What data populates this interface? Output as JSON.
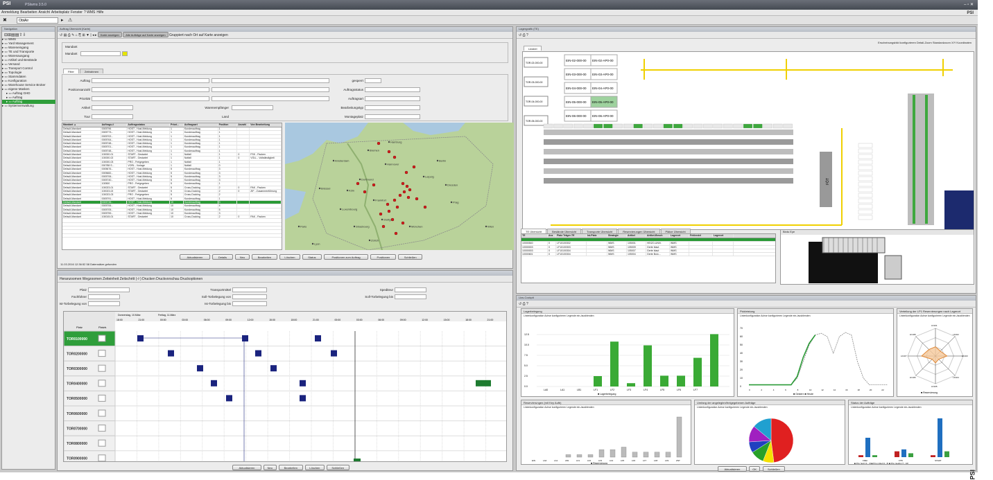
{
  "app": {
    "logo": "PSI",
    "title": "PSIwms 3.5.0",
    "brand": "PSI",
    "watermark": "PSI"
  },
  "menu": [
    "Anmeldung",
    "Bearbeiten",
    "Ansicht",
    "Arbeitsplatz",
    "Fenster",
    "? WMS",
    "Hilfe"
  ],
  "toolbar": {
    "search_value": "ObtAir"
  },
  "nav_panel": {
    "title": "Navigation"
  },
  "tree": [
    {
      "label": "WMS",
      "indent": 0
    },
    {
      "label": "Yard Management",
      "indent": 0
    },
    {
      "label": "Wareneingang",
      "indent": 0
    },
    {
      "label": "TE und Transporte",
      "indent": 0
    },
    {
      "label": "Warenausgang",
      "indent": 0
    },
    {
      "label": "Artikel und Bestände",
      "indent": 0
    },
    {
      "label": "Versand",
      "indent": 0
    },
    {
      "label": "Transport Control",
      "indent": 0
    },
    {
      "label": "Topologie",
      "indent": 0
    },
    {
      "label": "Stammdaten",
      "indent": 0
    },
    {
      "label": "Konfiguration",
      "indent": 0
    },
    {
      "label": "Warehouse Service Broker",
      "indent": 0
    },
    {
      "label": "eigene Masken",
      "indent": 0
    },
    {
      "label": "Auftrag GHD",
      "indent": 1
    },
    {
      "label": "Auftrag",
      "indent": 1
    },
    {
      "label": "Auftrag",
      "indent": 1,
      "selected": true
    },
    {
      "label": "Systemverwaltung",
      "indent": 0
    }
  ],
  "orders": {
    "panel_title": "Auftrag Übersicht (Karte)",
    "tb_buttons": [
      "Karte anzeigen",
      "Alle Aufträge auf Karte anzeigen"
    ],
    "tb_label": "Gruppiert nach Ort auf Karte anzeigen",
    "mandant_label": "Mandant",
    "tabs": [
      "Filter",
      "Zeitrahmen"
    ],
    "filter_labels": {
      "auftrag": "Auftrag",
      "positionsanzahl": "Positionsanzahl",
      "prioritaet": "Priorität",
      "artikel": "Artikel",
      "tour": "Tour",
      "gesperrt": "gesperrt",
      "auftragsstatus": "Auftragsstatus",
      "auftragsart": "Auftragsart",
      "bearbeitungstyp": "Bearbeitungstyp",
      "warenempfaenger": "Warenempfänger",
      "land": "Land",
      "montageplatz": "Montageplatz"
    },
    "columns": [
      "Mandant ▲",
      "Auftrags-#",
      "Auftragsstatus",
      "Priori...",
      "Auftragsart",
      "Position",
      "Anzahl",
      "Von Bearbeitung"
    ],
    "rows": [
      [
        "Default-Mandant",
        "0005796",
        "HOST - Host-Meldung",
        "1",
        "Kundenauftrag",
        "1",
        "",
        ""
      ],
      [
        "Default-Mandant",
        "0005773...",
        "HOST - Host-Meldung",
        "1",
        "Kundenauftrag",
        "1",
        "",
        ""
      ],
      [
        "Default-Mandant",
        "0005702...",
        "HOST - Host-Meldung",
        "1",
        "Kundenauftrag",
        "1",
        "",
        ""
      ],
      [
        "Default-Mandant",
        "0005764...",
        "HOST - Host-Meldung",
        "1",
        "Kundenauftrag",
        "1",
        "",
        ""
      ],
      [
        "Default-Mandant",
        "0005748...",
        "HOST - Host-Meldung",
        "1",
        "Kundenauftrag",
        "1",
        "",
        ""
      ],
      [
        "Default-Mandant",
        "0005701...",
        "HOST - Host-Meldung",
        "1",
        "Kundenauftrag",
        "1",
        "",
        ""
      ],
      [
        "Default-Mandant",
        "0005748...",
        "HOST - Host-Meldung",
        "1",
        "Kundenauftrag",
        "1",
        "",
        ""
      ],
      [
        "Default-Mandant",
        "100000-01",
        "START - Gestartet",
        "1",
        "Notfall",
        "1",
        "0",
        "FSK - Packen"
      ],
      [
        "Default-Mandant",
        "100000-02",
        "START - Gestartet",
        "1",
        "Notfall",
        "1",
        "0",
        "VOLL - Vollständigkeit"
      ],
      [
        "Default-Mandant",
        "100000-03",
        "PRO - Freigegeben",
        "1",
        "Notfall",
        "1",
        "",
        ""
      ],
      [
        "Default-Mandant",
        "000788 S...",
        "VORL - Vorlage",
        "1",
        "Notfall",
        "0",
        "",
        ""
      ],
      [
        "Default-Mandant",
        "0005676...",
        "HOST - Host-Meldung",
        "5",
        "Kundenauftrag",
        "3",
        "",
        ""
      ],
      [
        "Default-Mandant",
        "0005682...",
        "HOST - Host-Meldung",
        "5",
        "Kundenauftrag",
        "3",
        "",
        ""
      ],
      [
        "Default-Mandant",
        "0005706...",
        "HOST - Host-Meldung",
        "5",
        "Kundenauftrag",
        "3",
        "",
        ""
      ],
      [
        "Default-Mandant",
        "0005740...",
        "HOST - Host-Meldung",
        "5",
        "Kundenauftrag",
        "3",
        "",
        ""
      ],
      [
        "Default-Mandant",
        "100500",
        "PRO - Freigegeben",
        "5",
        "Kundenauftrag",
        "1",
        "",
        ""
      ],
      [
        "Default-Mandant",
        "100023-01",
        "START - Gestartet",
        "5",
        "Cross-Docking",
        "2",
        "0",
        "PAK - Packen"
      ],
      [
        "Default-Mandant",
        "100023-02",
        "START - Gestartet",
        "5",
        "Cross-Docking",
        "2",
        "0",
        "ZIF - Zusammenführung"
      ],
      [
        "Default-Mandant",
        "100023-03",
        "PRO - Freigegeben",
        "5",
        "Cross-Docking",
        "2",
        "",
        ""
      ],
      [
        "Default-Mandant",
        "0005791...",
        "HOST - Host-Meldung",
        "5",
        "Kundenauftrag",
        "1",
        "",
        ""
      ],
      [
        "Default-Mandant",
        "0005736...",
        "HOST - Host-Meldung",
        "10",
        "Kundenauftrag",
        "3",
        "",
        ""
      ],
      [
        "Default-Mandant",
        "0005706...",
        "HOST - Host-Meldung",
        "10",
        "Kundenauftrag",
        "4",
        "",
        ""
      ],
      [
        "Default-Mandant",
        "0005705...",
        "HOST - Host-Meldung",
        "10",
        "Kundenauftrag",
        "5",
        "",
        ""
      ],
      [
        "Default-Mandant",
        "0005759...",
        "HOST - Host-Meldung",
        "10",
        "Kundenauftrag",
        "3",
        "",
        ""
      ],
      [
        "Default-Mandant",
        "100015-01",
        "START - Gestartet",
        "10",
        "Cross-Docking",
        "2",
        "0",
        "PAK - Packen"
      ]
    ],
    "selected_row": 20,
    "buttons": [
      "Aktualisieren",
      "Details",
      "Neu",
      "Bearbeiten",
      "Löschen",
      "Status",
      "Positionen zum Auftrag",
      "Positionen",
      "Schließen"
    ],
    "status": "11.03.2016 12:36:52   58 Datensätze gefunden"
  },
  "map": {
    "cities": [
      "Hamburg",
      "Bremen",
      "Berlin",
      "Hannover",
      "Dortmund",
      "Leipzig",
      "Köln",
      "Dresden",
      "Frankfurt",
      "Prag",
      "Stuttgart",
      "München",
      "Zürich",
      "Wien",
      "Paris",
      "Amsterdam",
      "Brüssel",
      "Luxembourg",
      "Strasbourg",
      "Lyon"
    ]
  },
  "schedule": {
    "toolbar": "Heranzoomen  Wegzoomen  Zeiteinheit  Zeitschritt (-/-)  Drucken  Druckvorschau  Druckoptionen",
    "labels": {
      "platz": "Platz",
      "fachfuehrer": "Fachführer",
      "ist_torbelegung_von": "Ist-Torbelegung von",
      "transportmittel": "Transportmittel",
      "soll_torbelegung_von": "Soll-Torbelegung von",
      "ist_torbelegung_bis": "Ist-Torbelegung bis",
      "spediteur": "Spediteur",
      "soll_torbelegung_bis": "Soll-Torbelegung bis"
    },
    "col_platz": "Platz",
    "col_platzb": "Platzb.",
    "day1": "Donnerstag, 10.März",
    "day2": "Freitag, 11.März",
    "hours": [
      "18:00",
      "21:00",
      "00:00",
      "03:00",
      "06:00",
      "09:00",
      "12:00",
      "15:00",
      "18:00",
      "21:00",
      "00:00",
      "03:00",
      "06:00",
      "09:00",
      "12:00",
      "15:00",
      "18:00",
      "21:00"
    ],
    "gates": [
      "TOR0100000",
      "TOR0200000",
      "TOR0300000",
      "TOR0400000",
      "TOR0500000",
      "TOR0600000",
      "TOR0700000",
      "TOR0800000",
      "TOR0900000"
    ],
    "buttons": [
      "Aktualisieren",
      "Neu",
      "Bearbeiten",
      "Löschen",
      "Schließen"
    ]
  },
  "layout": {
    "panel_title": "Lagergrafik (TE)",
    "tb_right": "Erscheinungsbild konfigurieren   Detail-Zoom  Standardzoom   X/Y Koordinaten",
    "tab": "Lkwbel",
    "slot_labels": [
      "EIN-02-000-00",
      "EIN-02-AP0-00",
      "EIN-03-000-00",
      "EIN-03-AP0-00",
      "EIN-04-000-00",
      "EIN-04-AP0-00",
      "EIN-05-000-00",
      "EIN-05-AP0-00",
      "EIN-06-000-00",
      "EIN-06-AP0-00"
    ],
    "tor_labels": [
      "TOR-02-000-00",
      "TOR-03-000-00",
      "TOR-04-000-00",
      "TOR-05-000-00"
    ],
    "fot_label": "FÖT"
  },
  "stock": {
    "tabs": [
      "TE Übersicht",
      "Bestände Übersicht",
      "Transporte Übersicht",
      "Reservierungen Übersicht",
      "Plätze Übersicht"
    ],
    "columns": [
      "TE",
      "Anz",
      "Platz Träger-TE",
      "Ist-Platz",
      "Strategie",
      "Artikel",
      "Artikel-Besch",
      "Lagerort",
      "Fehlerziel",
      "Lagerort"
    ],
    "rows": [
      [
        "10000540",
        "0",
        "LF10100302",
        "",
        "WMS",
        "105001",
        "HEIZO-UNIV.",
        "WMS",
        "",
        ""
      ],
      [
        "10000003",
        "0",
        "LF10100303",
        "",
        "WMS",
        "105009",
        "Gerte blaut",
        "WMS",
        "",
        ""
      ],
      [
        "10000003",
        "0",
        "LF10100304",
        "",
        "WMS",
        "105007",
        "Gerte blaut",
        "WMS",
        "",
        ""
      ],
      [
        "10000601",
        "0",
        "LF10100304",
        "",
        "WMS",
        "105004",
        "Gerte Bolo...",
        "WMS",
        "",
        ""
      ]
    ],
    "birds_title": "Birds Eye"
  },
  "charts": {
    "panel_title": "Lkw-Cockpit",
    "cfg": "Linienkonfiguration  Achse konfigurieren  Legende ein-/ausblenden",
    "titles": [
      "Lagerbelegung",
      "Pickleistung",
      "Verteilung der LP1 Reservierungen nach Lagerort",
      "Reservierungen (mit Key Aufb)",
      "Umfang der angelegten/freigegebenen Aufträge",
      "Status der Aufträge"
    ],
    "legends": [
      "Lagerbelegung",
      "Gestern",
      "Heute",
      "Reservierung",
      "Reservierung",
      "Prio hoch [1 - 3]",
      "Prio mittel [4 - 6]",
      "Prio niedrig [7 - 10]"
    ],
    "buttons": [
      "Aktualisieren",
      "OK",
      "Schließen"
    ]
  },
  "chart_data": [
    {
      "type": "bar",
      "title": "Lagerbelegung",
      "categories": [
        "LA0",
        "LA1",
        "LB1",
        "LF1",
        "LF2",
        "LF3",
        "LF4",
        "LF5",
        "LF6",
        "LF7"
      ],
      "values": [
        0,
        0,
        0,
        2.5,
        10.8,
        0.8,
        9.9,
        2.6,
        2.6,
        6.9,
        12.6
      ],
      "ylim": [
        0,
        14
      ],
      "series": [
        {
          "name": "Lagerbelegung (% Belegt)"
        }
      ]
    },
    {
      "type": "line",
      "title": "Pickleistung",
      "x": [
        0,
        1,
        2,
        3,
        4,
        5,
        6,
        7,
        8,
        9,
        10,
        11,
        12,
        13,
        14,
        15,
        16,
        17,
        18,
        19,
        20,
        21,
        22,
        23
      ],
      "series": [
        {
          "name": "Gestern",
          "values": [
            2,
            2,
            2,
            2,
            2,
            2,
            2,
            2,
            10,
            30,
            50,
            62,
            64,
            60,
            40,
            60,
            65,
            62,
            30,
            10,
            2,
            2,
            2,
            2
          ]
        },
        {
          "name": "Heute",
          "values": [
            2,
            2,
            2,
            2,
            2,
            2,
            2,
            2,
            12,
            35,
            52,
            62,
            null,
            null,
            null,
            null,
            null,
            null,
            null,
            null,
            null,
            null,
            null,
            null
          ]
        }
      ],
      "ylim": [
        0,
        70
      ]
    },
    {
      "type": "radar",
      "title": "Verteilung der LP1 Reservierungen nach Lagerort",
      "categories": [
        "LF101",
        "LF102",
        "LF103",
        "LF104",
        "LF105",
        "LF106",
        "LF107",
        "LF108"
      ],
      "values": [
        8,
        6,
        10,
        4,
        6,
        4,
        12,
        8
      ]
    },
    {
      "type": "bar",
      "title": "Reservierungen (mit Key Aufb)",
      "categories": [
        "EIN",
        "LA0",
        "LA1",
        "LB1",
        "LF1",
        "LF2",
        "LF3",
        "LF4",
        "LF5",
        "LF6",
        "LF7",
        "LF8",
        "LF9",
        "ZNT"
      ],
      "values": [
        0,
        0,
        0,
        1,
        1,
        1,
        3,
        3,
        4,
        2,
        2,
        2,
        2,
        16
      ],
      "series": [
        {
          "name": "Reservierung"
        }
      ]
    },
    {
      "type": "pie",
      "title": "Umfang der angelegten/freigegebenen Aufträge",
      "values": [
        48,
        8,
        10,
        8,
        12,
        14
      ],
      "colors": [
        "#e02020",
        "#f5e000",
        "#28a028",
        "#2040c0",
        "#a020c0",
        "#20a0d0"
      ]
    },
    {
      "type": "bar",
      "title": "Status der Aufträge",
      "categories": [
        "FREI",
        "FTB",
        "START"
      ],
      "series": [
        {
          "name": "Prio hoch [1 - 3]",
          "values": [
            1,
            3,
            1
          ]
        },
        {
          "name": "Prio mittel [4 - 6]",
          "values": [
            10,
            4,
            20
          ]
        },
        {
          "name": "Prio niedrig [7 - 10]",
          "values": [
            1,
            2,
            3
          ]
        }
      ]
    }
  ]
}
